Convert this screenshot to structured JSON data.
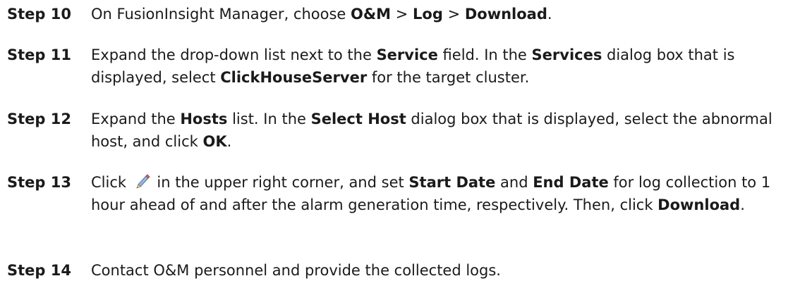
{
  "steps": [
    {
      "label": "Step 10",
      "parts": [
        "On FusionInsight Manager, choose ",
        "O&M",
        " > ",
        "Log",
        " > ",
        "Download",
        "."
      ]
    },
    {
      "label": "Step 11",
      "parts": [
        "Expand the drop-down list next to the ",
        "Service",
        " field. In the ",
        "Services",
        " dialog box that is displayed, select ",
        "ClickHouseServer",
        " for the target cluster."
      ]
    },
    {
      "label": "Step 12",
      "parts": [
        "Expand the ",
        "Hosts",
        " list. In the ",
        "Select Host",
        " dialog box that is displayed, select the abnormal host, and click ",
        "OK",
        "."
      ]
    },
    {
      "label": "Step 13",
      "icon": "pencil-edit-icon",
      "parts": [
        "Click ",
        " in the upper right corner, and set ",
        "Start Date",
        " and ",
        "End Date",
        " for log collection to 1 hour ahead of and after the alarm generation time, respectively. Then, click ",
        "Download",
        "."
      ]
    },
    {
      "label": "Step 14",
      "parts": [
        "Contact O&M personnel and provide the collected logs."
      ]
    }
  ]
}
